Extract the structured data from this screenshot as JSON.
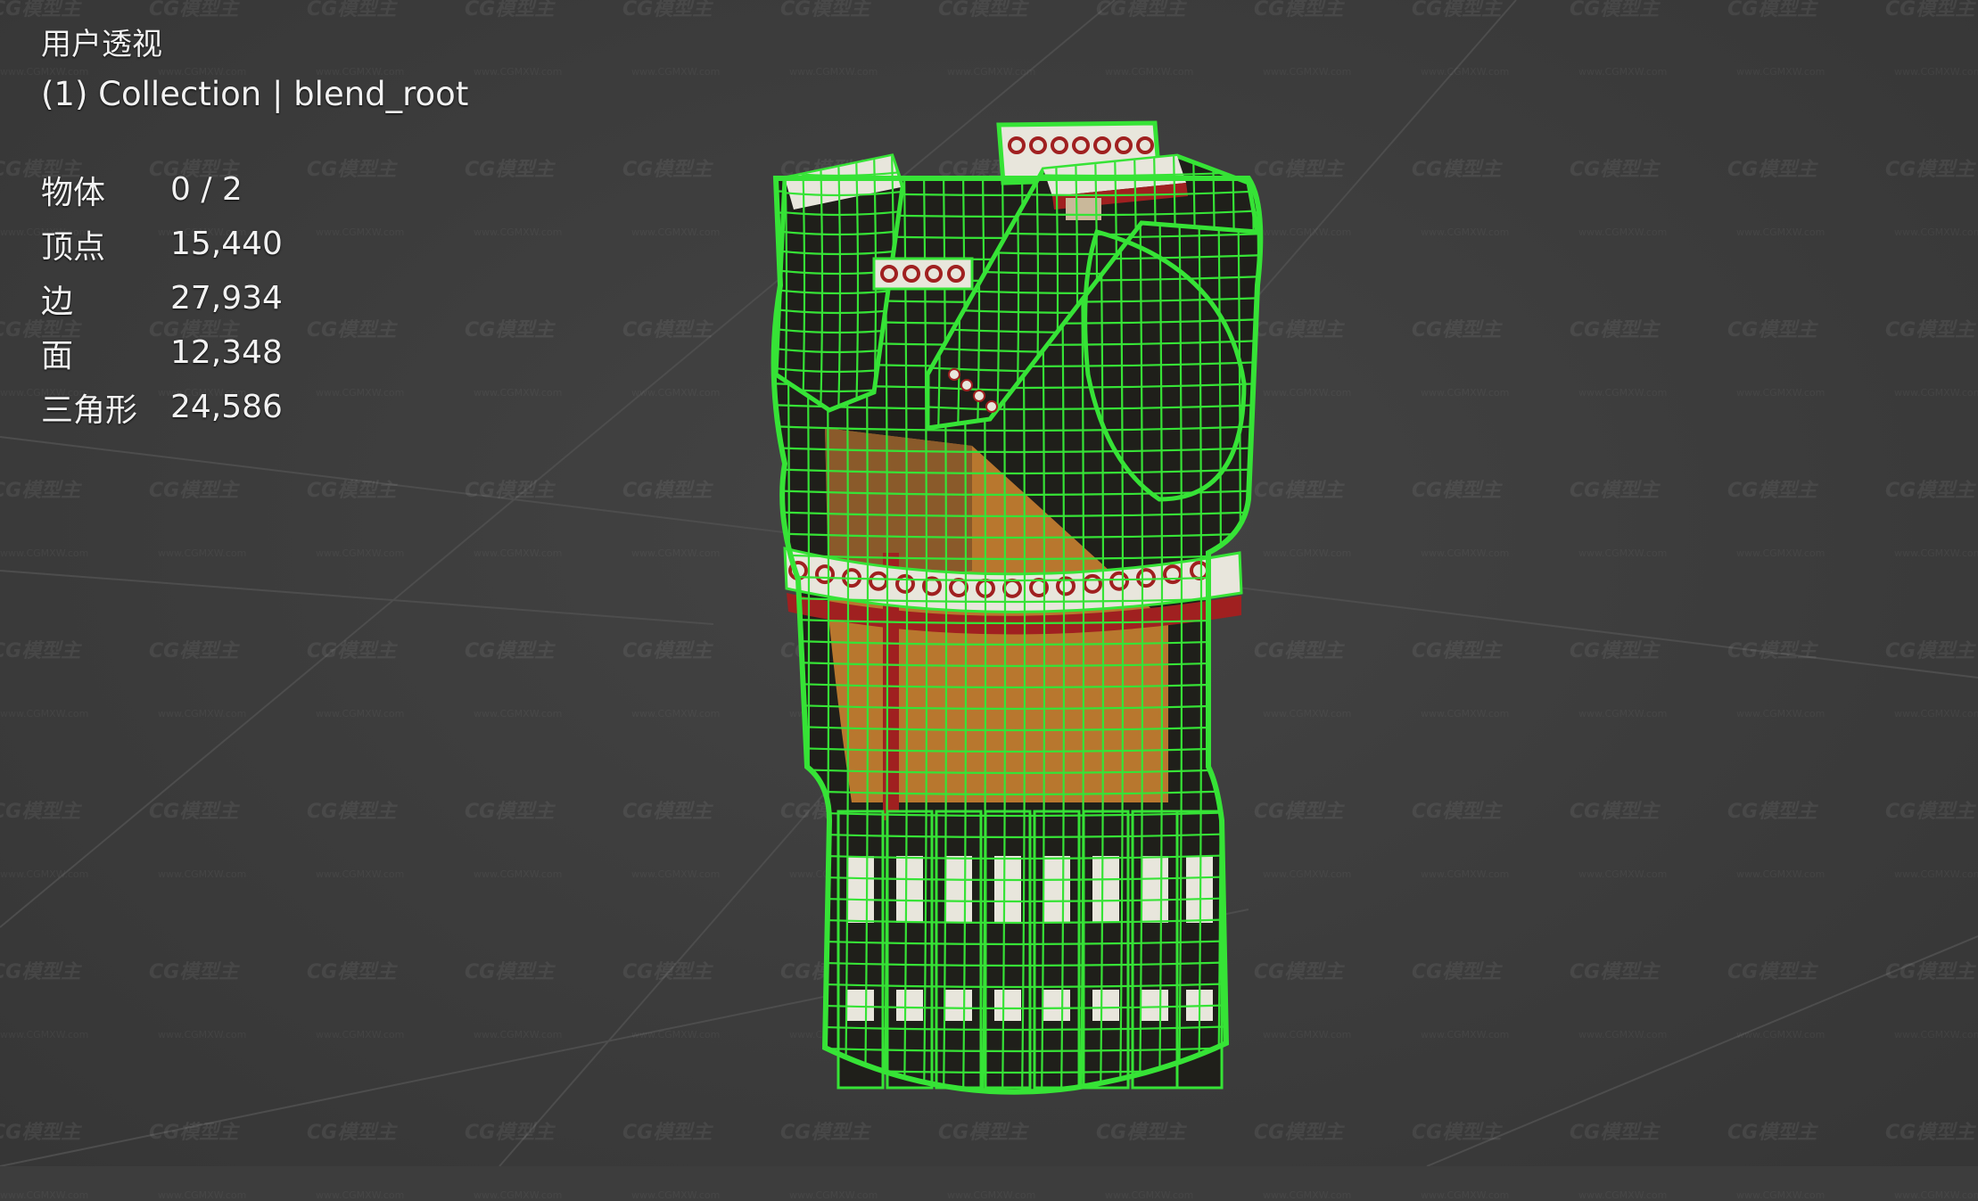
{
  "viewport": {
    "view_name": "用户透视",
    "collection_label": "(1) Collection | blend_root",
    "stats": [
      {
        "label": "物体",
        "value": "0 / 2"
      },
      {
        "label": "顶点",
        "value": "15,440"
      },
      {
        "label": "边",
        "value": "27,934"
      },
      {
        "label": "面",
        "value": "12,348"
      },
      {
        "label": "三角形",
        "value": "24,586"
      }
    ]
  },
  "watermark": {
    "text": "CG模型主",
    "subtext": "www.CGMXW.com"
  },
  "colors": {
    "background": "#3d3d3d",
    "wireframe": "#36e336",
    "grid_line": "#4d4d4d",
    "fabric_orange": "#b8772e",
    "fabric_dark": "#1f1f1a",
    "trim_red": "#a02020",
    "trim_white": "#e8e6dc"
  }
}
